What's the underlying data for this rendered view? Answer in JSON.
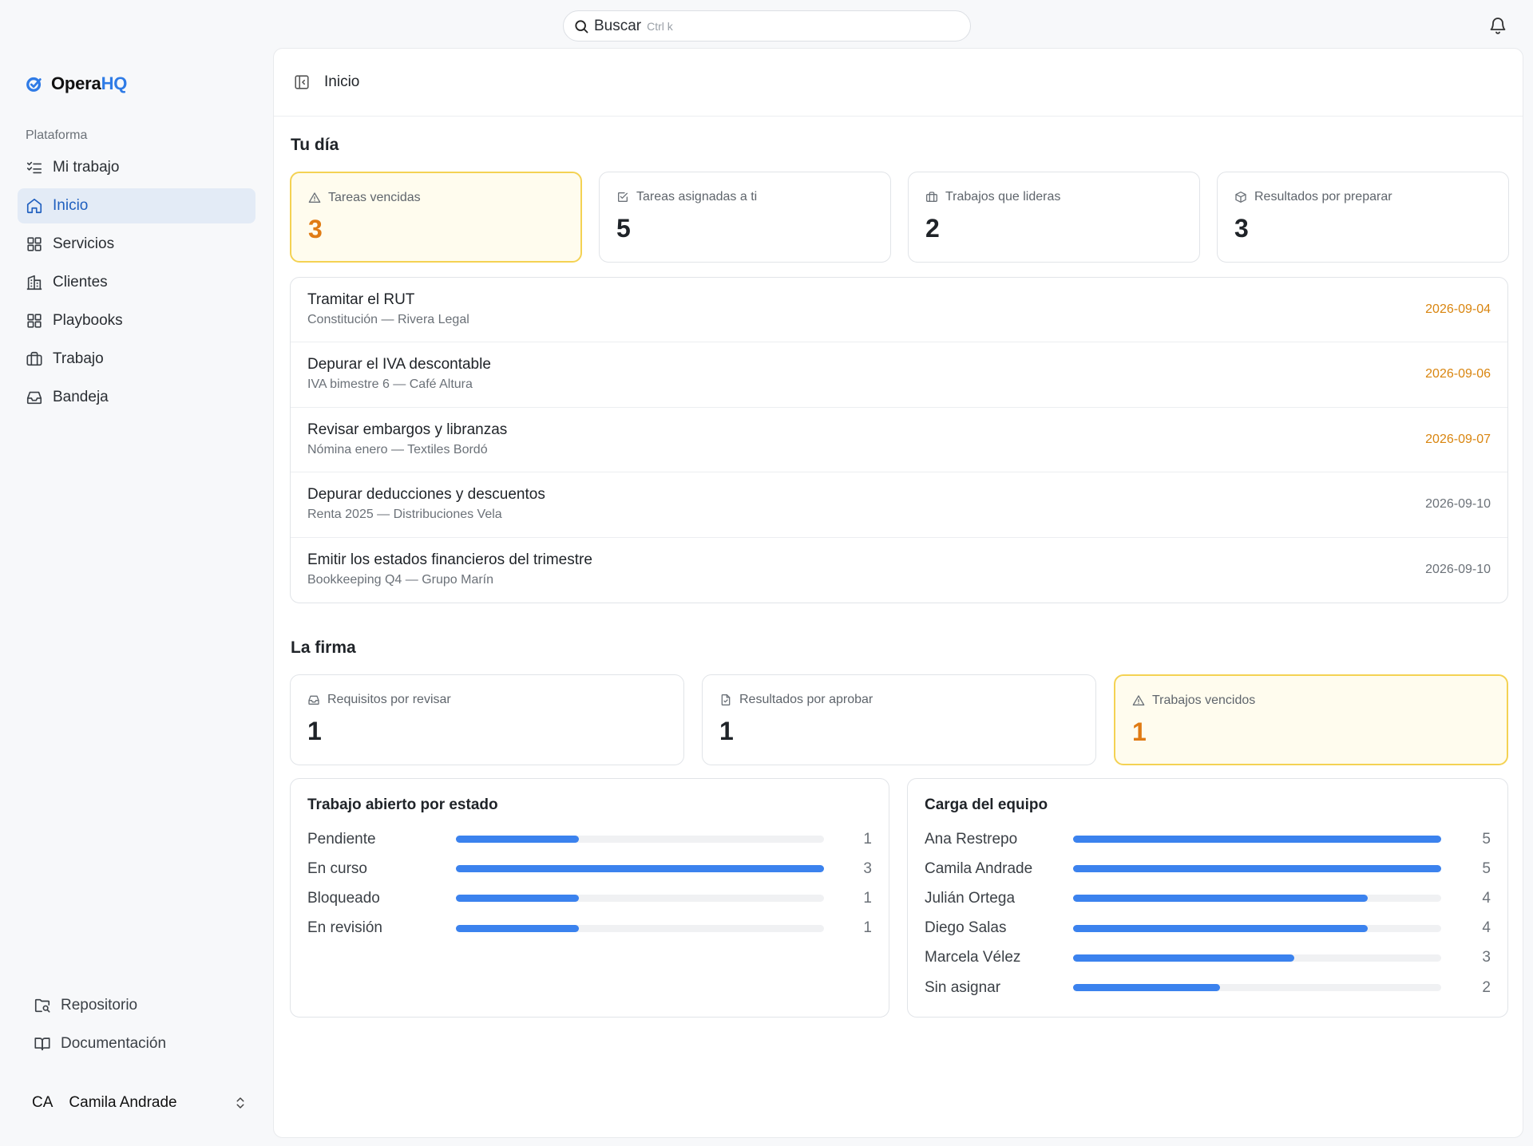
{
  "search": {
    "label": "Buscar",
    "shortcut": "Ctrl k"
  },
  "brand": {
    "name_a": "Opera",
    "name_b": "HQ"
  },
  "sidebar": {
    "section_label": "Plataforma",
    "items": [
      {
        "label": "Mi trabajo",
        "icon": "list-check-icon"
      },
      {
        "label": "Inicio",
        "icon": "home-icon"
      },
      {
        "label": "Servicios",
        "icon": "grid-icon"
      },
      {
        "label": "Clientes",
        "icon": "building-icon"
      },
      {
        "label": "Playbooks",
        "icon": "grid-icon"
      },
      {
        "label": "Trabajo",
        "icon": "briefcase-icon"
      },
      {
        "label": "Bandeja",
        "icon": "inbox-icon"
      }
    ],
    "bottom": [
      {
        "label": "Repositorio",
        "icon": "folder-search-icon"
      },
      {
        "label": "Documentación",
        "icon": "book-icon"
      }
    ],
    "user": {
      "initials": "CA",
      "name": "Camila Andrade"
    }
  },
  "page": {
    "title": "Inicio"
  },
  "tu_dia": {
    "heading": "Tu día",
    "stats": [
      {
        "label": "Tareas vencidas",
        "value": "3",
        "icon": "alert-triangle-icon",
        "warn": true
      },
      {
        "label": "Tareas asignadas a ti",
        "value": "5",
        "icon": "checkbox-icon",
        "warn": false
      },
      {
        "label": "Trabajos que lideras",
        "value": "2",
        "icon": "briefcase-icon",
        "warn": false
      },
      {
        "label": "Resultados por preparar",
        "value": "3",
        "icon": "package-icon",
        "warn": false
      }
    ],
    "tasks": [
      {
        "title": "Tramitar el RUT",
        "subtitle": "Constitución — Rivera Legal",
        "date": "2026-09-04",
        "late": true
      },
      {
        "title": "Depurar el IVA descontable",
        "subtitle": "IVA bimestre 6 — Café Altura",
        "date": "2026-09-06",
        "late": true
      },
      {
        "title": "Revisar embargos y libranzas",
        "subtitle": "Nómina enero — Textiles Bordó",
        "date": "2026-09-07",
        "late": true
      },
      {
        "title": "Depurar deducciones y descuentos",
        "subtitle": "Renta 2025 — Distribuciones Vela",
        "date": "2026-09-10",
        "late": false
      },
      {
        "title": "Emitir los estados financieros del trimestre",
        "subtitle": "Bookkeeping Q4 — Grupo Marín",
        "date": "2026-09-10",
        "late": false
      }
    ]
  },
  "la_firma": {
    "heading": "La firma",
    "stats": [
      {
        "label": "Requisitos por revisar",
        "value": "1",
        "icon": "inbox-icon",
        "warn": false
      },
      {
        "label": "Resultados por aprobar",
        "value": "1",
        "icon": "file-check-icon",
        "warn": false
      },
      {
        "label": "Trabajos vencidos",
        "value": "1",
        "icon": "alert-triangle-icon",
        "warn": true
      }
    ],
    "estado": {
      "title": "Trabajo abierto por estado",
      "max": 3,
      "rows": [
        {
          "label": "Pendiente",
          "value": 1
        },
        {
          "label": "En curso",
          "value": 3
        },
        {
          "label": "Bloqueado",
          "value": 1
        },
        {
          "label": "En revisión",
          "value": 1
        }
      ]
    },
    "equipo": {
      "title": "Carga del equipo",
      "max": 5,
      "rows": [
        {
          "label": "Ana Restrepo",
          "value": 5
        },
        {
          "label": "Camila Andrade",
          "value": 5
        },
        {
          "label": "Julián Ortega",
          "value": 4
        },
        {
          "label": "Diego Salas",
          "value": 4
        },
        {
          "label": "Marcela Vélez",
          "value": 3
        },
        {
          "label": "Sin asignar",
          "value": 2
        }
      ]
    }
  },
  "colors": {
    "accent": "#3b82ee",
    "warn_value": "#e07b14",
    "warn_date": "#d9850f",
    "warn_border": "#f4d253"
  }
}
